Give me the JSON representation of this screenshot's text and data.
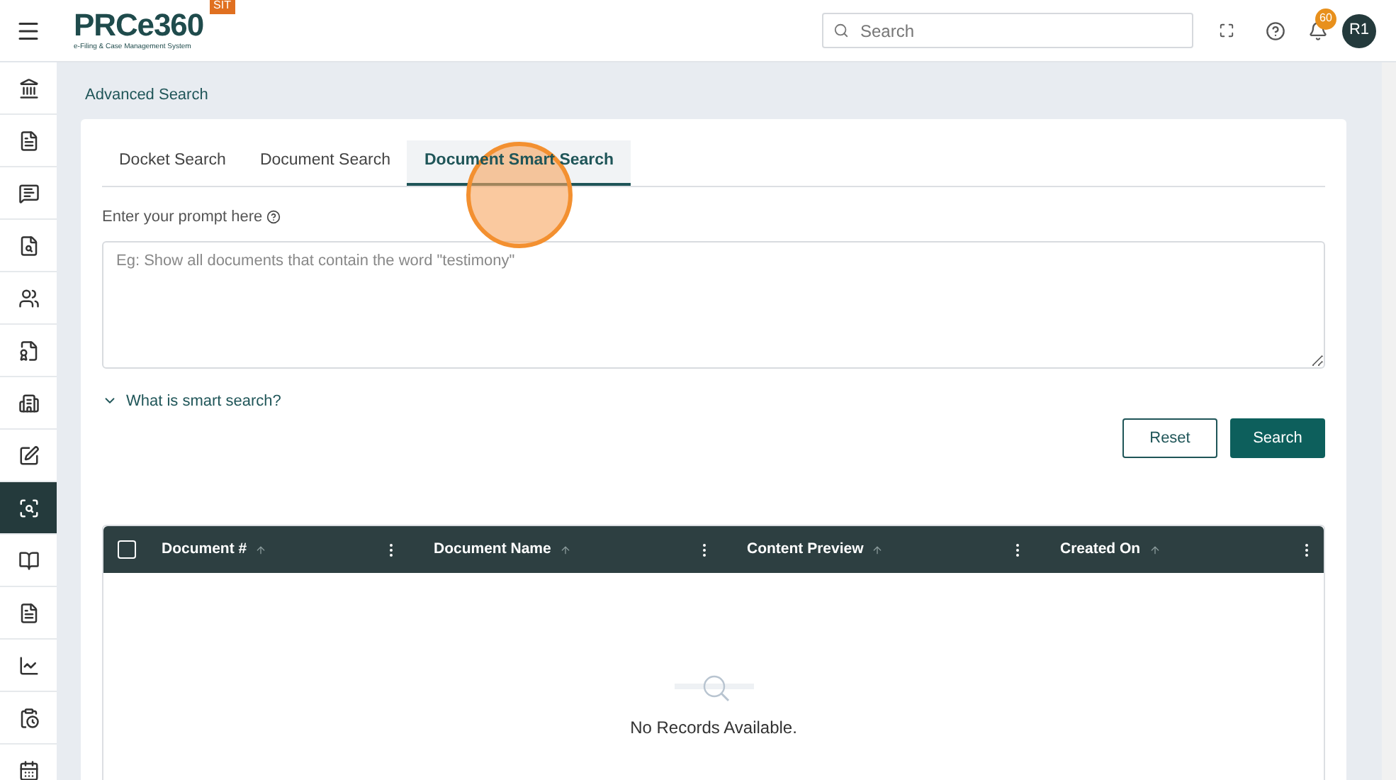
{
  "header": {
    "logo": "PRCe360",
    "logo_subtitle": "e-Filing & Case Management System",
    "env_badge": "SIT",
    "search": {
      "placeholder": "Search"
    },
    "notification_count": "60",
    "avatar": "R1"
  },
  "sidebar": {
    "items": [
      {
        "kind": "landmark",
        "selected": false
      },
      {
        "kind": "file",
        "selected": false
      },
      {
        "kind": "message",
        "selected": false
      },
      {
        "kind": "file-search",
        "selected": false
      },
      {
        "kind": "users",
        "selected": false
      },
      {
        "kind": "file-dollar",
        "selected": false
      },
      {
        "kind": "building",
        "selected": false
      },
      {
        "kind": "text-box",
        "selected": false
      },
      {
        "kind": "scan-search",
        "selected": true
      },
      {
        "kind": "book",
        "selected": false
      },
      {
        "kind": "file",
        "selected": false
      },
      {
        "kind": "chart",
        "selected": false
      },
      {
        "kind": "clipboard-clock",
        "selected": false
      },
      {
        "kind": "calendar",
        "selected": false
      }
    ]
  },
  "breadcrumb": "Advanced Search",
  "tabs": [
    {
      "label": "Docket Search",
      "selected": false
    },
    {
      "label": "Document Search",
      "selected": false
    },
    {
      "label": "Document Smart Search",
      "selected": true
    }
  ],
  "prompt_label": "Enter your prompt here",
  "prompt": {
    "placeholder": "Eg: Show all documents that contain the word \"testimony\""
  },
  "help_toggle": {
    "label": "What is smart search?",
    "expanded": false
  },
  "buttons": [
    "Reset",
    "Search"
  ],
  "table": {
    "select_all": {
      "checked": false
    },
    "columns": [
      "Document #",
      "Document Name",
      "Content Preview",
      "Created On"
    ],
    "empty_message": "No Records Available."
  }
}
